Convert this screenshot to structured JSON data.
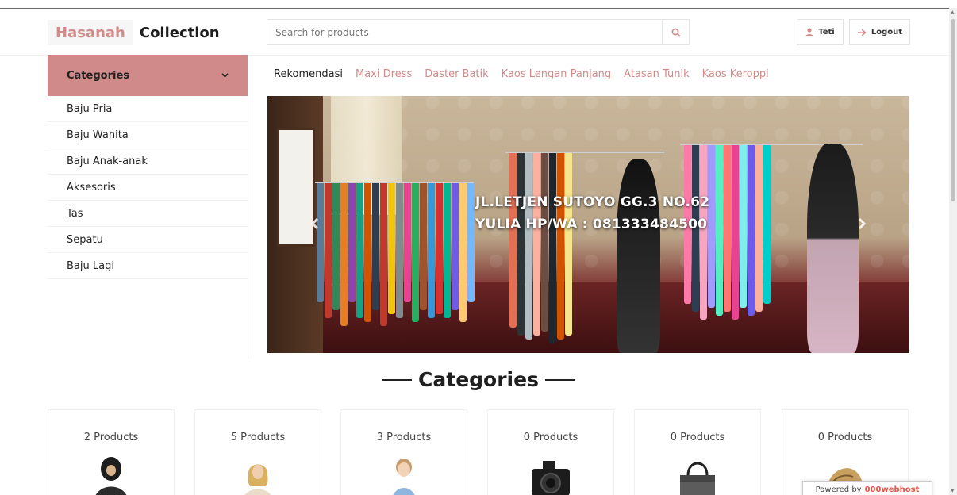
{
  "brand": {
    "part1": "Hasanah",
    "part2": "Collection"
  },
  "search": {
    "placeholder": "Search for products",
    "icon": "search-icon"
  },
  "user": {
    "name": "Teti",
    "icon": "user-icon"
  },
  "logout": {
    "label": "Logout",
    "icon": "arrow-right-icon"
  },
  "sidebar": {
    "title": "Categories",
    "items": [
      {
        "label": "Baju Pria"
      },
      {
        "label": "Baju Wanita"
      },
      {
        "label": "Baju Anak-anak"
      },
      {
        "label": "Aksesoris"
      },
      {
        "label": "Tas"
      },
      {
        "label": "Sepatu"
      },
      {
        "label": "Baju Lagi"
      }
    ]
  },
  "nav": {
    "tabs": [
      {
        "label": "Rekomendasi"
      },
      {
        "label": "Maxi Dress"
      },
      {
        "label": "Daster Batik"
      },
      {
        "label": "Kaos Lengan Panjang"
      },
      {
        "label": "Atasan Tunik"
      },
      {
        "label": "Kaos Keroppi"
      }
    ]
  },
  "banner": {
    "line1": "JL.LETJEN SUTOYO GG.3 NO.62",
    "line2": "YULIA HP/WA : 081333484500",
    "prev_icon": "chevron-left-icon",
    "next_icon": "chevron-right-icon"
  },
  "section": {
    "title": "Categories"
  },
  "cards": [
    {
      "count": "2 Products",
      "image": "hijab-woman-image"
    },
    {
      "count": "5 Products",
      "image": "woman-image"
    },
    {
      "count": "3 Products",
      "image": "child-image"
    },
    {
      "count": "0 Products",
      "image": "camera-image"
    },
    {
      "count": "0 Products",
      "image": "handbag-image"
    },
    {
      "count": "0 Products",
      "image": "shoe-image"
    }
  ],
  "powered": {
    "prefix": "Powered by",
    "logo": "000webhost"
  },
  "colors": {
    "accent": "#d08a89",
    "text": "#222222"
  }
}
